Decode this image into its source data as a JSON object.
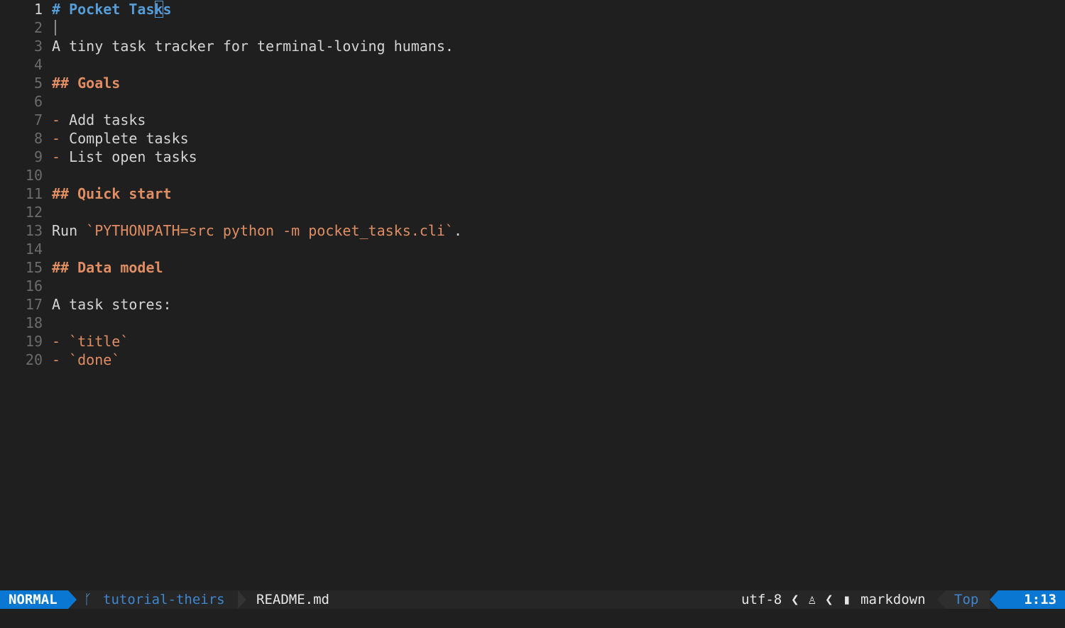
{
  "editor": {
    "lines": [
      {
        "n": "1",
        "segs": [
          {
            "t": "# Pocket Tas",
            "c": "h1"
          },
          {
            "t": "k",
            "c": "h1 cursor"
          },
          {
            "t": "s",
            "c": "h1"
          }
        ]
      },
      {
        "n": "2",
        "segs": []
      },
      {
        "n": "3",
        "segs": [
          {
            "t": "A tiny task tracker for terminal-loving humans.",
            "c": ""
          }
        ]
      },
      {
        "n": "4",
        "segs": []
      },
      {
        "n": "5",
        "segs": [
          {
            "t": "## Goals",
            "c": "h2"
          }
        ]
      },
      {
        "n": "6",
        "segs": []
      },
      {
        "n": "7",
        "segs": [
          {
            "t": "- ",
            "c": "bullet"
          },
          {
            "t": "Add tasks",
            "c": ""
          }
        ]
      },
      {
        "n": "8",
        "segs": [
          {
            "t": "- ",
            "c": "bullet"
          },
          {
            "t": "Complete tasks",
            "c": ""
          }
        ]
      },
      {
        "n": "9",
        "segs": [
          {
            "t": "- ",
            "c": "bullet"
          },
          {
            "t": "List open tasks",
            "c": ""
          }
        ]
      },
      {
        "n": "10",
        "segs": []
      },
      {
        "n": "11",
        "segs": [
          {
            "t": "## Quick start",
            "c": "h2"
          }
        ]
      },
      {
        "n": "12",
        "segs": []
      },
      {
        "n": "13",
        "segs": [
          {
            "t": "Run ",
            "c": ""
          },
          {
            "t": "`PYTHONPATH=src python -m pocket_tasks.cli`",
            "c": "code"
          },
          {
            "t": ".",
            "c": ""
          }
        ]
      },
      {
        "n": "14",
        "segs": []
      },
      {
        "n": "15",
        "segs": [
          {
            "t": "## Data model",
            "c": "h2"
          }
        ]
      },
      {
        "n": "16",
        "segs": []
      },
      {
        "n": "17",
        "segs": [
          {
            "t": "A task stores:",
            "c": ""
          }
        ]
      },
      {
        "n": "18",
        "segs": []
      },
      {
        "n": "19",
        "segs": [
          {
            "t": "- ",
            "c": "bullet"
          },
          {
            "t": "`title`",
            "c": "code"
          }
        ]
      },
      {
        "n": "20",
        "segs": [
          {
            "t": "- ",
            "c": "bullet"
          },
          {
            "t": "`done`",
            "c": "code"
          }
        ]
      }
    ]
  },
  "statusbar": {
    "mode": "NORMAL",
    "branch_icon": "git-branch-icon",
    "branch": "tutorial-theirs",
    "filename": "README.md",
    "encoding": "utf-8",
    "os_icon": "linux-icon",
    "filetype_icon": "file-icon",
    "filetype": "markdown",
    "scroll": "Top",
    "position": "1:13"
  }
}
